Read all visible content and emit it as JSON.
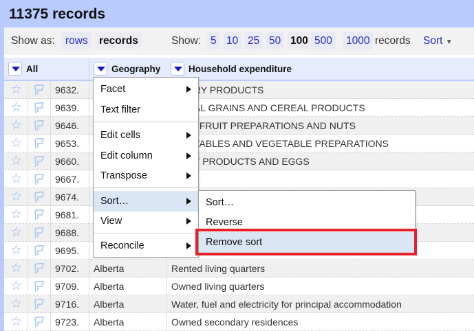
{
  "title": "11375 records",
  "toolbar": {
    "show_as_label": "Show as:",
    "rows": "rows",
    "records": "records",
    "show_label": "Show:",
    "sizes": [
      "5",
      "10",
      "25",
      "50",
      "100",
      "500",
      "1000"
    ],
    "selected_size": "100",
    "records_suffix": "records",
    "sort": "Sort"
  },
  "columns": {
    "all": "All",
    "geography": "Geography",
    "household": "Household expenditure"
  },
  "rows": [
    {
      "index": "9632.",
      "geo": "",
      "exp": "RY PRODUCTS"
    },
    {
      "index": "9639.",
      "geo": "",
      "exp": "AL GRAINS AND CEREAL PRODUCTS"
    },
    {
      "index": "9646.",
      "geo": "",
      "exp": ", FRUIT PREPARATIONS AND NUTS"
    },
    {
      "index": "9653.",
      "geo": "",
      "exp": "TABLES AND VEGETABLE PREPARATIONS"
    },
    {
      "index": "9660.",
      "geo": "",
      "exp": "T PRODUCTS AND EGGS"
    },
    {
      "index": "9667.",
      "geo": "",
      "exp": ""
    },
    {
      "index": "9674.",
      "geo": "",
      "exp": ""
    },
    {
      "index": "9681.",
      "geo": "",
      "exp": ""
    },
    {
      "index": "9688.",
      "geo": "",
      "exp": ""
    },
    {
      "index": "9695.",
      "geo": "",
      "exp": ""
    },
    {
      "index": "9702.",
      "geo": "Alberta",
      "exp": "Rented living quarters"
    },
    {
      "index": "9709.",
      "geo": "Alberta",
      "exp": "Owned living quarters"
    },
    {
      "index": "9716.",
      "geo": "Alberta",
      "exp": "Water, fuel and electricity for principal accommodation"
    },
    {
      "index": "9723.",
      "geo": "Alberta",
      "exp": "Owned secondary residences"
    }
  ],
  "menu": {
    "facet": "Facet",
    "text_filter": "Text filter",
    "edit_cells": "Edit cells",
    "edit_column": "Edit column",
    "transpose": "Transpose",
    "sort": "Sort…",
    "view": "View",
    "reconcile": "Reconcile"
  },
  "submenu": {
    "sort": "Sort…",
    "reverse": "Reverse",
    "remove_sort": "Remove sort"
  },
  "colors": {
    "accent": "#b9cbff",
    "highlight": "#dae5f5",
    "callout": "#e5202a"
  }
}
